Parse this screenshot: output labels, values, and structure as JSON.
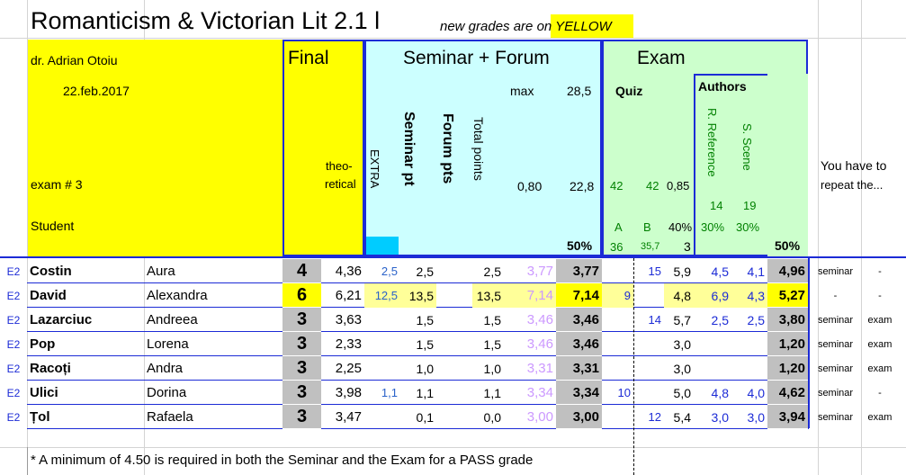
{
  "title": "Romanticism & Victorian Lit 2.1 l",
  "yellow_note": "new grades are on YELLOW",
  "info": {
    "teacher": "dr. Adrian Otoiu",
    "date": "22.feb.2017",
    "exam": "exam # 3",
    "student_label": "Student"
  },
  "headers": {
    "final": "Final",
    "theo_1": "theo-",
    "theo_2": "retical",
    "seminar_forum": "Seminar + Forum",
    "extra": "EXTRA",
    "seminar_pt": "Seminar pt",
    "forum_pts": "Forum pts",
    "total_points": "Total points",
    "max": "max",
    "max_val": "28,5",
    "val_080": "0,80",
    "val_228": "22,8",
    "pct_sem": "50%",
    "exam": "Exam",
    "quiz": "Quiz",
    "authors": "Authors",
    "r_reference": "R. Reference",
    "s_scene": "S. Scene",
    "q42a": "42",
    "q42b": "42",
    "q085": "0,85",
    "a14": "14",
    "a19": "19",
    "lA": "A",
    "lB": "B",
    "p40": "40%",
    "p30a": "30%",
    "p30b": "30%",
    "v36": "36",
    "v357": "35,7",
    "v3": "3",
    "pct_exam": "50%",
    "repeat_1": "You have to",
    "repeat_2": "repeat the..."
  },
  "rows": [
    {
      "grp": "E2",
      "last": "Costin",
      "first": "Aura",
      "final": "4",
      "theo": "4,36",
      "extra": "2,5",
      "sem": "2,5",
      "forum": "",
      "tot": "2,5",
      "calc": "3,77",
      "semres": "3,77",
      "qa": "",
      "qb": "15",
      "quiz": "5,9",
      "rr": "4,5",
      "ss": "4,1",
      "exam": "4,96",
      "rep1": "seminar",
      "rep2": "-",
      "hl": false
    },
    {
      "grp": "E2",
      "last": "David",
      "first": "Alexandra",
      "final": "6",
      "theo": "6,21",
      "extra": "12,5",
      "sem": "13,5",
      "forum": "",
      "tot": "13,5",
      "calc": "7,14",
      "semres": "7,14",
      "qa": "9",
      "qb": "",
      "quiz": "4,8",
      "rr": "6,9",
      "ss": "4,3",
      "exam": "5,27",
      "rep1": "-",
      "rep2": "-",
      "hl": true
    },
    {
      "grp": "E2",
      "last": "Lazarciuc",
      "first": "Andreea",
      "final": "3",
      "theo": "3,63",
      "extra": "",
      "sem": "1,5",
      "forum": "",
      "tot": "1,5",
      "calc": "3,46",
      "semres": "3,46",
      "qa": "",
      "qb": "14",
      "quiz": "5,7",
      "rr": "2,5",
      "ss": "2,5",
      "exam": "3,80",
      "rep1": "seminar",
      "rep2": "exam",
      "hl": false
    },
    {
      "grp": "E2",
      "last": "Pop",
      "first": "Lorena",
      "final": "3",
      "theo": "2,33",
      "extra": "",
      "sem": "1,5",
      "forum": "",
      "tot": "1,5",
      "calc": "3,46",
      "semres": "3,46",
      "qa": "",
      "qb": "",
      "quiz": "3,0",
      "rr": "",
      "ss": "",
      "exam": "1,20",
      "rep1": "seminar",
      "rep2": "exam",
      "hl": false
    },
    {
      "grp": "E2",
      "last": "Racoți",
      "first": "Andra",
      "final": "3",
      "theo": "2,25",
      "extra": "",
      "sem": "1,0",
      "forum": "",
      "tot": "1,0",
      "calc": "3,31",
      "semres": "3,31",
      "qa": "",
      "qb": "",
      "quiz": "3,0",
      "rr": "",
      "ss": "",
      "exam": "1,20",
      "rep1": "seminar",
      "rep2": "exam",
      "hl": false
    },
    {
      "grp": "E2",
      "last": "Ulici",
      "first": "Dorina",
      "final": "3",
      "theo": "3,98",
      "extra": "1,1",
      "sem": "1,1",
      "forum": "",
      "tot": "1,1",
      "calc": "3,34",
      "semres": "3,34",
      "qa": "10",
      "qb": "",
      "quiz": "5,0",
      "rr": "4,8",
      "ss": "4,0",
      "exam": "4,62",
      "rep1": "seminar",
      "rep2": "-",
      "hl": false
    },
    {
      "grp": "E2",
      "last": "Țol",
      "first": "Rafaela",
      "final": "3",
      "theo": "3,47",
      "extra": "",
      "sem": "0,1",
      "forum": "",
      "tot": "0,0",
      "calc": "3,00",
      "semres": "3,00",
      "qa": "",
      "qb": "12",
      "quiz": "5,4",
      "rr": "3,0",
      "ss": "3,0",
      "exam": "3,94",
      "rep1": "seminar",
      "rep2": "exam",
      "hl": false
    }
  ],
  "footnote": "* A minimum of 4.50 is required in both the Seminar and the Exam for a PASS grade"
}
